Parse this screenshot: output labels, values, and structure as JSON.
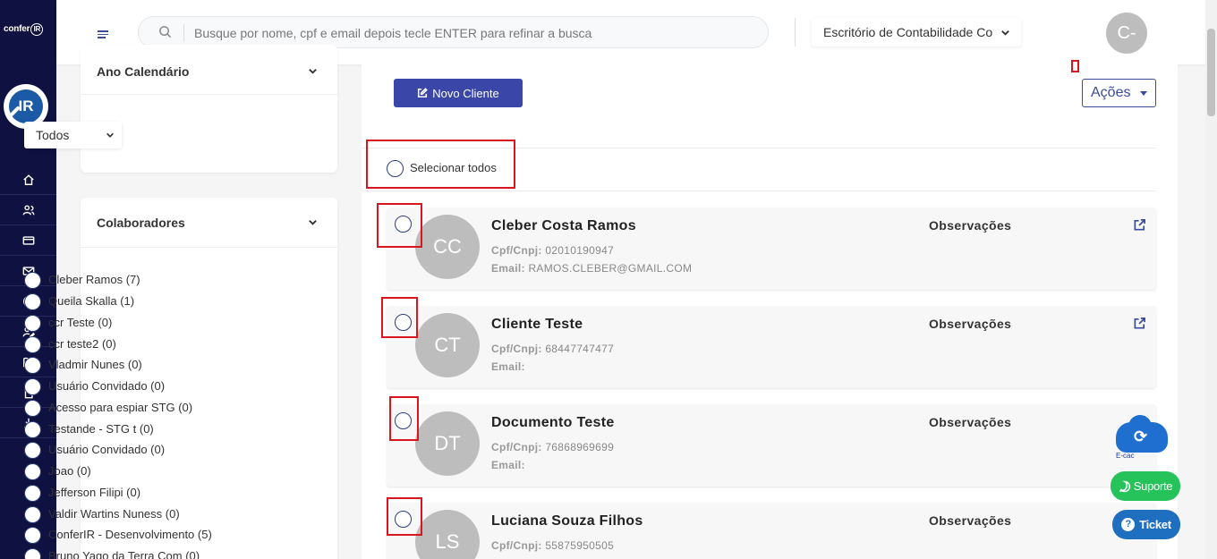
{
  "brand": {
    "logo_text": "confer",
    "logo_badge": "IR",
    "circle_text": "IR"
  },
  "nav_icons": [
    "home-icon",
    "users-icon",
    "card-icon",
    "mail-icon",
    "chart-pie-icon",
    "user-edit-icon",
    "book-icon",
    "file-icon",
    "download-icon"
  ],
  "header": {
    "search_placeholder": "Busque por nome, cpf e email depois tecle ENTER para refinar a busca",
    "office_select": "Escritório de Contabilidade Co",
    "avatar_initials": "C-"
  },
  "filters": {
    "year_title": "Ano Calendário",
    "year_value": "Todos",
    "collab_title": "Colaboradores",
    "collaborators": [
      "Cleber Ramos (7)",
      "Queila Skalla (1)",
      "ccr Teste (0)",
      "ccr teste2 (0)",
      "Vladmir Nunes (0)",
      "Usuário Convidado (0)",
      "Acesso para espiar STG (0)",
      "Testande - STG t (0)",
      "Usuário Convidado (0)",
      "Joao (0)",
      "Jefferson Filipi (0)",
      "Valdir Wartins Nuness (0)",
      "ConferIR - Desenvolvimento (5)",
      "Bruno Yago da Terra Com (0)"
    ]
  },
  "main": {
    "new_client_label": "Novo Cliente",
    "actions_label": "Ações",
    "select_all_label": "Selecionar todos",
    "doc_label": "Cpf/Cnpj:",
    "email_label": "Email:",
    "obs_label": "Observações",
    "clients": [
      {
        "initials": "CC",
        "name": "Cleber Costa Ramos",
        "doc": "02010190947",
        "email": "RAMOS.CLEBER@GMAIL.COM"
      },
      {
        "initials": "CT",
        "name": "Cliente Teste",
        "doc": "68447747477",
        "email": ""
      },
      {
        "initials": "DT",
        "name": "Documento Teste",
        "doc": "76868969699",
        "email": ""
      },
      {
        "initials": "LS",
        "name": "Luciana Souza Filhos",
        "doc": "55875950505",
        "email": ""
      }
    ]
  },
  "widgets": {
    "ecac_label": "E-cac",
    "support_label": "Suporte",
    "ticket_label": "Ticket"
  },
  "colors": {
    "sidebar": "#0f1140",
    "primary": "#3a47a8",
    "highlight": "#d9161d",
    "whatsapp": "#25c35a",
    "ticket": "#1f6fc0"
  }
}
